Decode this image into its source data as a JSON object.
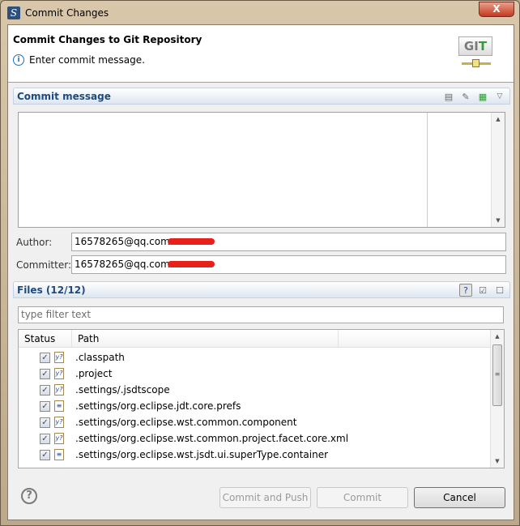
{
  "window": {
    "title": "Commit Changes",
    "close_label": "X"
  },
  "banner": {
    "title": "Commit Changes to Git Repository",
    "message": "Enter commit message.",
    "logo_text": "GIT"
  },
  "commit_message": {
    "section_label": "Commit message",
    "value": ""
  },
  "author": {
    "label": "Author:",
    "value": "16578265@qq.com"
  },
  "committer": {
    "label": "Committer:",
    "value": "16578265@qq.com"
  },
  "files": {
    "section_label": "Files (12/12)",
    "filter_placeholder": "type filter text",
    "columns": [
      "Status",
      "Path"
    ],
    "rows": [
      {
        "path": ".classpath",
        "checked": true,
        "icon": "untracked-file-icon"
      },
      {
        "path": ".project",
        "checked": true,
        "icon": "untracked-file-icon"
      },
      {
        "path": ".settings/.jsdtscope",
        "checked": true,
        "icon": "untracked-file-icon"
      },
      {
        "path": ".settings/org.eclipse.jdt.core.prefs",
        "checked": true,
        "icon": "text-file-icon"
      },
      {
        "path": ".settings/org.eclipse.wst.common.component",
        "checked": true,
        "icon": "untracked-file-icon"
      },
      {
        "path": ".settings/org.eclipse.wst.common.project.facet.core.xml",
        "checked": true,
        "icon": "untracked-file-icon"
      },
      {
        "path": ".settings/org.eclipse.wst.jsdt.ui.superType.container",
        "checked": true,
        "icon": "text-file-icon"
      }
    ]
  },
  "buttons": {
    "commit_and_push": "Commit and Push",
    "commit": "Commit",
    "cancel": "Cancel",
    "help": "?"
  }
}
